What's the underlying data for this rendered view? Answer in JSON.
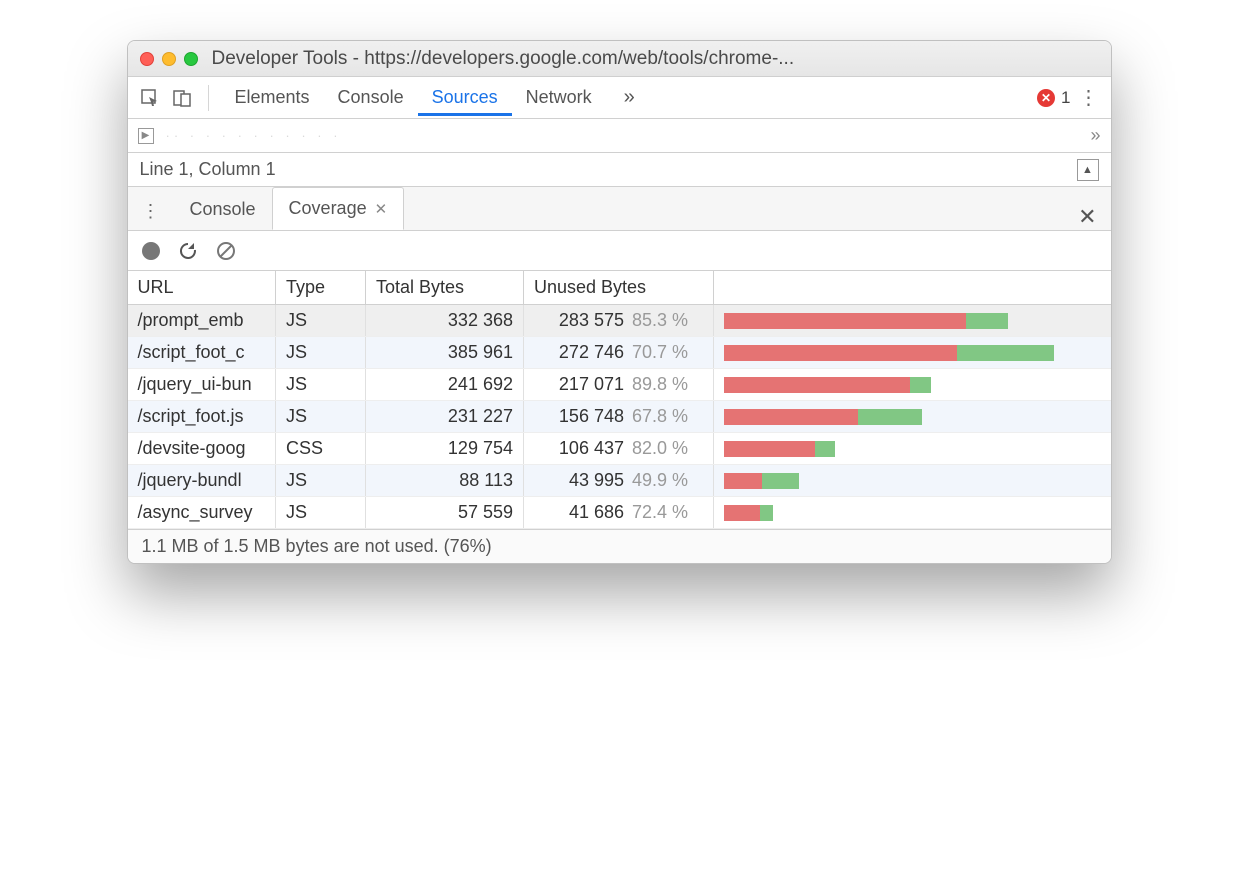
{
  "window": {
    "title": "Developer Tools - https://developers.google.com/web/tools/chrome-..."
  },
  "toolbar": {
    "tabs": [
      "Elements",
      "Console",
      "Sources",
      "Network"
    ],
    "active_tab": "Sources",
    "overflow_glyph": "»",
    "error_count": "1"
  },
  "status": {
    "cursor": "Line 1, Column 1"
  },
  "drawer": {
    "tabs": [
      {
        "label": "Console",
        "active": false
      },
      {
        "label": "Coverage",
        "active": true
      }
    ]
  },
  "coverage": {
    "headers": {
      "url": "URL",
      "type": "Type",
      "total": "Total Bytes",
      "unused": "Unused Bytes"
    },
    "max_total": 385961,
    "rows": [
      {
        "url": "/prompt_emb",
        "type": "JS",
        "total": "332 368",
        "total_n": 332368,
        "unused": "283 575",
        "unused_n": 283575,
        "pct": "85.3 %",
        "selected": true
      },
      {
        "url": "/script_foot_c",
        "type": "JS",
        "total": "385 961",
        "total_n": 385961,
        "unused": "272 746",
        "unused_n": 272746,
        "pct": "70.7 %"
      },
      {
        "url": "/jquery_ui-bun",
        "type": "JS",
        "total": "241 692",
        "total_n": 241692,
        "unused": "217 071",
        "unused_n": 217071,
        "pct": "89.8 %"
      },
      {
        "url": "/script_foot.js",
        "type": "JS",
        "total": "231 227",
        "total_n": 231227,
        "unused": "156 748",
        "unused_n": 156748,
        "pct": "67.8 %"
      },
      {
        "url": "/devsite-goog",
        "type": "CSS",
        "total": "129 754",
        "total_n": 129754,
        "unused": "106 437",
        "unused_n": 106437,
        "pct": "82.0 %"
      },
      {
        "url": "/jquery-bundl",
        "type": "JS",
        "total": "88 113",
        "total_n": 88113,
        "unused": "43 995",
        "unused_n": 43995,
        "pct": "49.9 %"
      },
      {
        "url": "/async_survey",
        "type": "JS",
        "total": "57 559",
        "total_n": 57559,
        "unused": "41 686",
        "unused_n": 41686,
        "pct": "72.4 %"
      }
    ],
    "footer": "1.1 MB of 1.5 MB bytes are not used. (76%)"
  }
}
